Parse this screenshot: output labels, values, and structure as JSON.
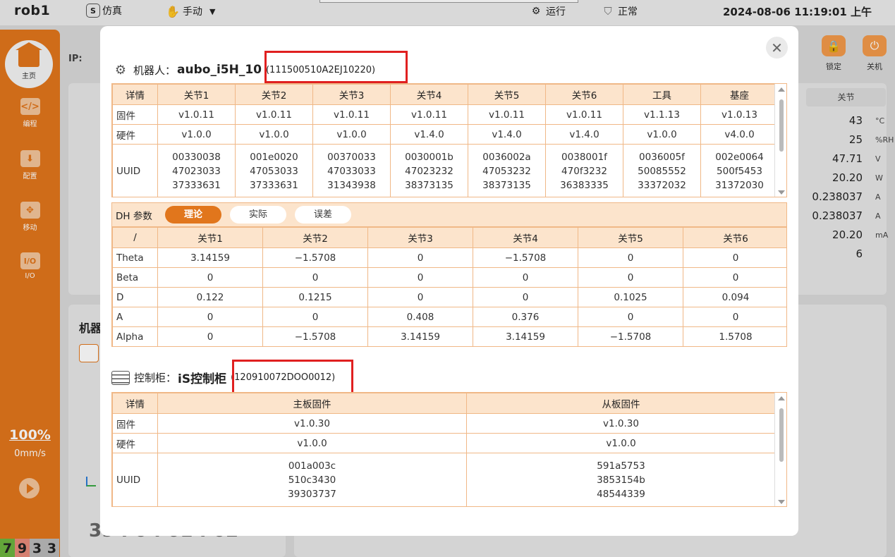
{
  "topbar": {
    "app_title": "rob1",
    "sim_label": "仿真",
    "mode_label": "手动",
    "run_label": "运行",
    "status_label": "正常",
    "datetime": "2024-08-06 11:19:01 上午"
  },
  "sidebar": {
    "items": [
      {
        "label": "主页",
        "icon": "home-icon"
      },
      {
        "label": "编程",
        "icon": "code-icon"
      },
      {
        "label": "配置",
        "icon": "config-icon"
      },
      {
        "label": "移动",
        "icon": "move-icon"
      },
      {
        "label": "I/O",
        "icon": "io-icon"
      }
    ],
    "speed_pct": "100%",
    "speed_mms": "0mm/s",
    "counts": [
      "7",
      "9",
      "3",
      "3"
    ],
    "count_colors": [
      "#6cb33f",
      "#e57373",
      "#9e9e9e",
      "#9e9e9e"
    ]
  },
  "background": {
    "ip_label": "IP:",
    "right_buttons": [
      {
        "label": "锁定"
      },
      {
        "label": "关机"
      }
    ],
    "joint_header": "关节",
    "values": [
      {
        "value": "43",
        "unit": "°C"
      },
      {
        "value": "25",
        "unit": "%RH"
      },
      {
        "value": "47.71",
        "unit": "V"
      },
      {
        "value": "20.20",
        "unit": "W"
      },
      {
        "value": "0.238037",
        "unit": "A"
      },
      {
        "value": "0.238037",
        "unit": "A"
      },
      {
        "value": "20.20",
        "unit": "mA"
      },
      {
        "value": "6",
        "unit": ""
      }
    ],
    "robot_label": "机器",
    "timer": "39 : 0 : 01 : 02"
  },
  "modal": {
    "robot": {
      "label": "机器人：",
      "name": "aubo_i5H_10",
      "serial": "(111500510A2EJ10220)"
    },
    "robot_table": {
      "headers": [
        "详情",
        "关节1",
        "关节2",
        "关节3",
        "关节4",
        "关节5",
        "关节6",
        "工具",
        "基座"
      ],
      "rows": [
        {
          "label": "固件",
          "cells": [
            "v1.0.11",
            "v1.0.11",
            "v1.0.11",
            "v1.0.11",
            "v1.0.11",
            "v1.0.11",
            "v1.1.13",
            "v1.0.13"
          ]
        },
        {
          "label": "硬件",
          "cells": [
            "v1.0.0",
            "v1.0.0",
            "v1.0.0",
            "v1.4.0",
            "v1.4.0",
            "v1.4.0",
            "v1.0.0",
            "v4.0.0"
          ]
        }
      ],
      "uuid_label": "UUID",
      "uuids": [
        [
          "00330038",
          "47023033",
          "37333631"
        ],
        [
          "001e0020",
          "47053033",
          "37333631"
        ],
        [
          "00370033",
          "47033033",
          "31343938"
        ],
        [
          "0030001b",
          "47023232",
          "38373135"
        ],
        [
          "0036002a",
          "47053232",
          "38373135"
        ],
        [
          "0038001f",
          "470f3232",
          "36383335"
        ],
        [
          "0036005f",
          "50085552",
          "33372032"
        ],
        [
          "002e0064",
          "500f5453",
          "31372030"
        ]
      ]
    },
    "dh": {
      "label": "DH 参数",
      "tabs": [
        {
          "label": "理论",
          "active": true
        },
        {
          "label": "实际",
          "active": false
        },
        {
          "label": "误差",
          "active": false
        }
      ],
      "headers": [
        "/",
        "关节1",
        "关节2",
        "关节3",
        "关节4",
        "关节5",
        "关节6"
      ],
      "rows": [
        {
          "label": "Theta",
          "cells": [
            "3.14159",
            "−1.5708",
            "0",
            "−1.5708",
            "0",
            "0"
          ]
        },
        {
          "label": "Beta",
          "cells": [
            "0",
            "0",
            "0",
            "0",
            "0",
            "0"
          ]
        },
        {
          "label": "D",
          "cells": [
            "0.122",
            "0.1215",
            "0",
            "0",
            "0.1025",
            "0.094"
          ]
        },
        {
          "label": "A",
          "cells": [
            "0",
            "0",
            "0.408",
            "0.376",
            "0",
            "0"
          ]
        },
        {
          "label": "Alpha",
          "cells": [
            "0",
            "−1.5708",
            "3.14159",
            "3.14159",
            "−1.5708",
            "1.5708"
          ]
        }
      ]
    },
    "cabinet": {
      "label": "控制柜：",
      "name": "iS控制柜",
      "serial": "(120910072DOO0012)"
    },
    "cabinet_table": {
      "headers": [
        "详情",
        "主板固件",
        "从板固件"
      ],
      "rows": [
        {
          "label": "固件",
          "cells": [
            "v1.0.30",
            "v1.0.30"
          ]
        },
        {
          "label": "硬件",
          "cells": [
            "v1.0.0",
            "v1.0.0"
          ]
        }
      ],
      "uuid_label": "UUID",
      "uuids": [
        [
          "001a003c",
          "510c3430",
          "39303737"
        ],
        [
          "591a5753",
          "3853154b",
          "48544339"
        ]
      ]
    },
    "close_icon": "close-icon"
  }
}
